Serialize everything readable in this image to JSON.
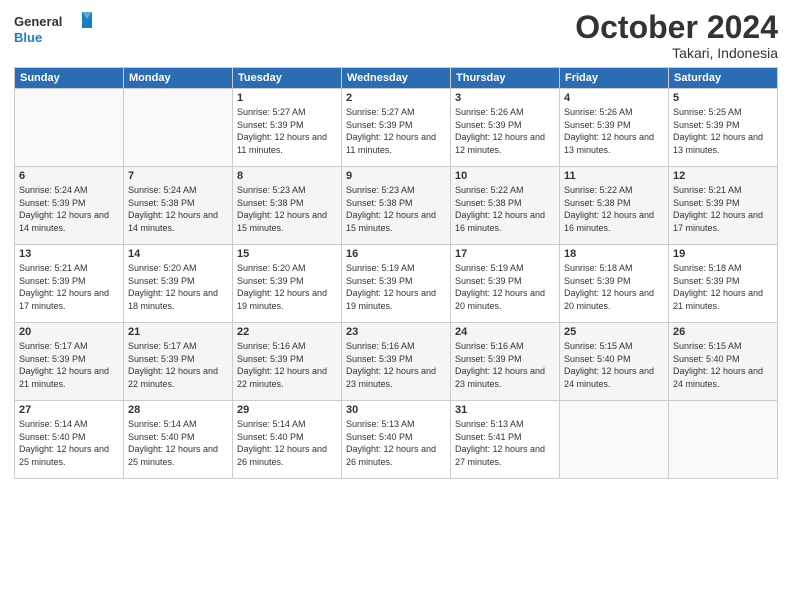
{
  "logo": {
    "general": "General",
    "blue": "Blue"
  },
  "header": {
    "month": "October 2024",
    "location": "Takari, Indonesia"
  },
  "weekdays": [
    "Sunday",
    "Monday",
    "Tuesday",
    "Wednesday",
    "Thursday",
    "Friday",
    "Saturday"
  ],
  "weeks": [
    [
      {
        "day": "",
        "info": ""
      },
      {
        "day": "",
        "info": ""
      },
      {
        "day": "1",
        "info": "Sunrise: 5:27 AM\nSunset: 5:39 PM\nDaylight: 12 hours and 11 minutes."
      },
      {
        "day": "2",
        "info": "Sunrise: 5:27 AM\nSunset: 5:39 PM\nDaylight: 12 hours and 11 minutes."
      },
      {
        "day": "3",
        "info": "Sunrise: 5:26 AM\nSunset: 5:39 PM\nDaylight: 12 hours and 12 minutes."
      },
      {
        "day": "4",
        "info": "Sunrise: 5:26 AM\nSunset: 5:39 PM\nDaylight: 12 hours and 13 minutes."
      },
      {
        "day": "5",
        "info": "Sunrise: 5:25 AM\nSunset: 5:39 PM\nDaylight: 12 hours and 13 minutes."
      }
    ],
    [
      {
        "day": "6",
        "info": "Sunrise: 5:24 AM\nSunset: 5:39 PM\nDaylight: 12 hours and 14 minutes."
      },
      {
        "day": "7",
        "info": "Sunrise: 5:24 AM\nSunset: 5:38 PM\nDaylight: 12 hours and 14 minutes."
      },
      {
        "day": "8",
        "info": "Sunrise: 5:23 AM\nSunset: 5:38 PM\nDaylight: 12 hours and 15 minutes."
      },
      {
        "day": "9",
        "info": "Sunrise: 5:23 AM\nSunset: 5:38 PM\nDaylight: 12 hours and 15 minutes."
      },
      {
        "day": "10",
        "info": "Sunrise: 5:22 AM\nSunset: 5:38 PM\nDaylight: 12 hours and 16 minutes."
      },
      {
        "day": "11",
        "info": "Sunrise: 5:22 AM\nSunset: 5:38 PM\nDaylight: 12 hours and 16 minutes."
      },
      {
        "day": "12",
        "info": "Sunrise: 5:21 AM\nSunset: 5:39 PM\nDaylight: 12 hours and 17 minutes."
      }
    ],
    [
      {
        "day": "13",
        "info": "Sunrise: 5:21 AM\nSunset: 5:39 PM\nDaylight: 12 hours and 17 minutes."
      },
      {
        "day": "14",
        "info": "Sunrise: 5:20 AM\nSunset: 5:39 PM\nDaylight: 12 hours and 18 minutes."
      },
      {
        "day": "15",
        "info": "Sunrise: 5:20 AM\nSunset: 5:39 PM\nDaylight: 12 hours and 19 minutes."
      },
      {
        "day": "16",
        "info": "Sunrise: 5:19 AM\nSunset: 5:39 PM\nDaylight: 12 hours and 19 minutes."
      },
      {
        "day": "17",
        "info": "Sunrise: 5:19 AM\nSunset: 5:39 PM\nDaylight: 12 hours and 20 minutes."
      },
      {
        "day": "18",
        "info": "Sunrise: 5:18 AM\nSunset: 5:39 PM\nDaylight: 12 hours and 20 minutes."
      },
      {
        "day": "19",
        "info": "Sunrise: 5:18 AM\nSunset: 5:39 PM\nDaylight: 12 hours and 21 minutes."
      }
    ],
    [
      {
        "day": "20",
        "info": "Sunrise: 5:17 AM\nSunset: 5:39 PM\nDaylight: 12 hours and 21 minutes."
      },
      {
        "day": "21",
        "info": "Sunrise: 5:17 AM\nSunset: 5:39 PM\nDaylight: 12 hours and 22 minutes."
      },
      {
        "day": "22",
        "info": "Sunrise: 5:16 AM\nSunset: 5:39 PM\nDaylight: 12 hours and 22 minutes."
      },
      {
        "day": "23",
        "info": "Sunrise: 5:16 AM\nSunset: 5:39 PM\nDaylight: 12 hours and 23 minutes."
      },
      {
        "day": "24",
        "info": "Sunrise: 5:16 AM\nSunset: 5:39 PM\nDaylight: 12 hours and 23 minutes."
      },
      {
        "day": "25",
        "info": "Sunrise: 5:15 AM\nSunset: 5:40 PM\nDaylight: 12 hours and 24 minutes."
      },
      {
        "day": "26",
        "info": "Sunrise: 5:15 AM\nSunset: 5:40 PM\nDaylight: 12 hours and 24 minutes."
      }
    ],
    [
      {
        "day": "27",
        "info": "Sunrise: 5:14 AM\nSunset: 5:40 PM\nDaylight: 12 hours and 25 minutes."
      },
      {
        "day": "28",
        "info": "Sunrise: 5:14 AM\nSunset: 5:40 PM\nDaylight: 12 hours and 25 minutes."
      },
      {
        "day": "29",
        "info": "Sunrise: 5:14 AM\nSunset: 5:40 PM\nDaylight: 12 hours and 26 minutes."
      },
      {
        "day": "30",
        "info": "Sunrise: 5:13 AM\nSunset: 5:40 PM\nDaylight: 12 hours and 26 minutes."
      },
      {
        "day": "31",
        "info": "Sunrise: 5:13 AM\nSunset: 5:41 PM\nDaylight: 12 hours and 27 minutes."
      },
      {
        "day": "",
        "info": ""
      },
      {
        "day": "",
        "info": ""
      }
    ]
  ]
}
